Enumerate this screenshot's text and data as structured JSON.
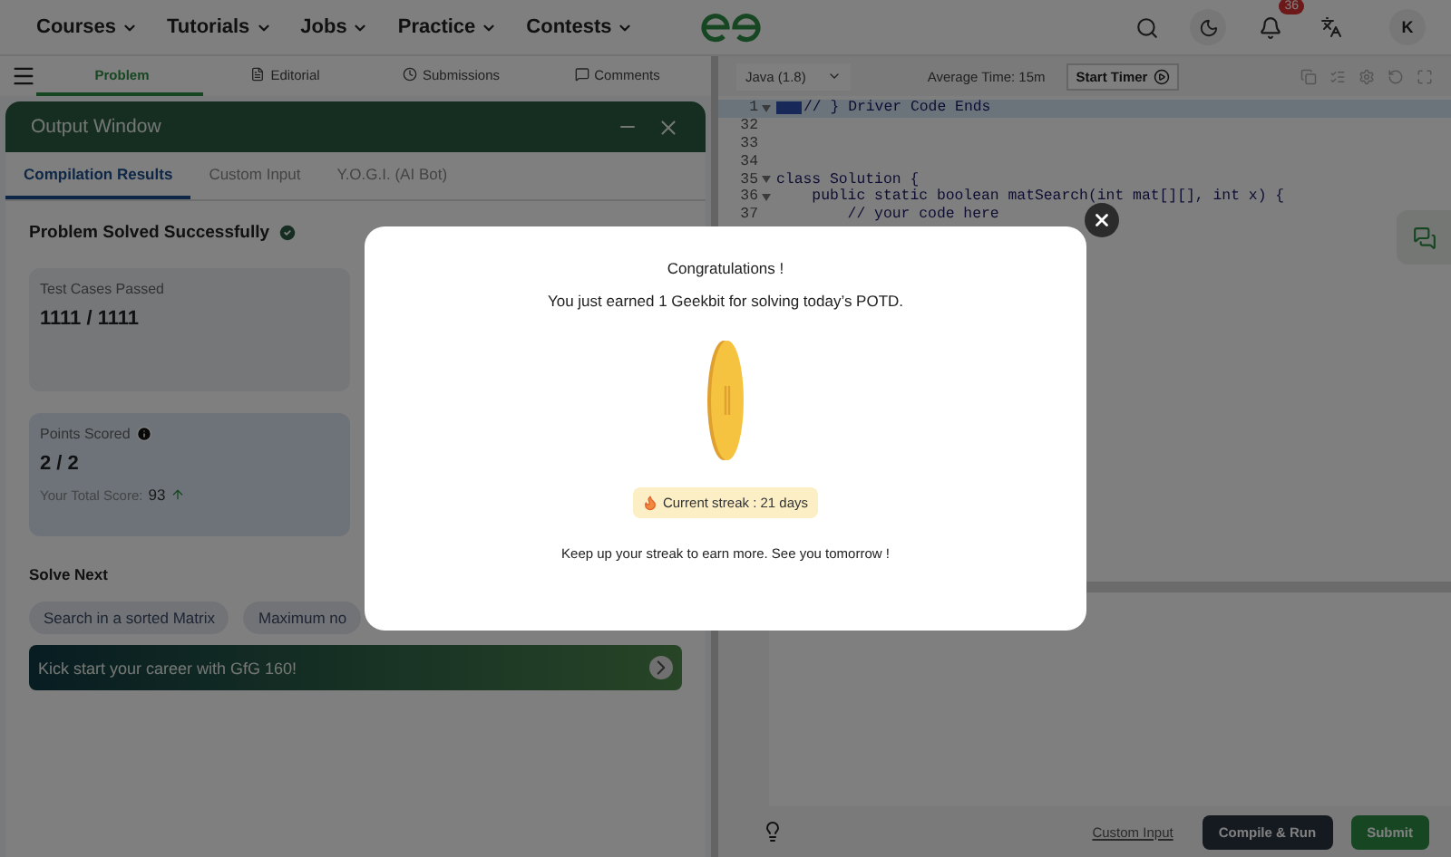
{
  "nav": {
    "menus": [
      "Courses",
      "Tutorials",
      "Jobs",
      "Practice",
      "Contests"
    ],
    "notification_count": "36",
    "avatar": "K"
  },
  "problem_tabs": [
    {
      "label": "Problem",
      "selected": true,
      "kind": "code"
    },
    {
      "label": "Editorial",
      "selected": false,
      "kind": "doc"
    },
    {
      "label": "Submissions",
      "selected": false,
      "kind": "clock"
    },
    {
      "label": "Comments",
      "selected": false,
      "kind": "comment"
    }
  ],
  "editor_toolbar": {
    "language": "Java (1.8)",
    "average_time": "Average Time: 15m",
    "timer_button": "Start Timer"
  },
  "code_lines": [
    {
      "number": "1",
      "text": "// } Driver Code Ends",
      "highlighted": true,
      "foldable": true
    },
    {
      "number": "32",
      "highlighted": false,
      "foldable": false
    },
    {
      "number": "33",
      "highlighted": false,
      "foldable": false
    },
    {
      "number": "34",
      "highlighted": false,
      "foldable": false
    },
    {
      "number": "35",
      "text": "class Solution {",
      "highlighted": false,
      "foldable": true
    },
    {
      "number": "36",
      "text": "    public static boolean matSearch(int mat[][], int x) {",
      "highlighted": false,
      "foldable": true
    },
    {
      "number": "37",
      "text": "        // your code here",
      "highlighted": false,
      "foldable": false
    }
  ],
  "output_window": {
    "title": "Output Window",
    "tabs": [
      {
        "label": "Compilation Results",
        "selected": true
      },
      {
        "label": "Custom Input",
        "selected": false
      },
      {
        "label": "Y.O.G.I. (AI Bot)",
        "selected": false
      }
    ],
    "status": "Problem Solved Successfully",
    "test_cases": {
      "label": "Test Cases Passed",
      "value": "1111 / 1111"
    },
    "points": {
      "label": "Points Scored",
      "value": "2 / 2",
      "total_label": "Your Total Score:",
      "total_value": "93"
    },
    "solve_next_title": "Solve Next",
    "solve_next": [
      "Search in a sorted Matrix",
      "Maximum no"
    ],
    "banner": "Kick start your career with GfG 160!"
  },
  "footer": {
    "custom_input": "Custom Input",
    "compile_button": "Compile & Run",
    "submit_button": "Submit"
  },
  "modal": {
    "title": "Congratulations !",
    "message": "You just earned 1 Geekbit for solving today’s POTD.",
    "streak": "Current streak : 21 days",
    "footer": "Keep up your streak to earn more. See you tomorrow !"
  }
}
